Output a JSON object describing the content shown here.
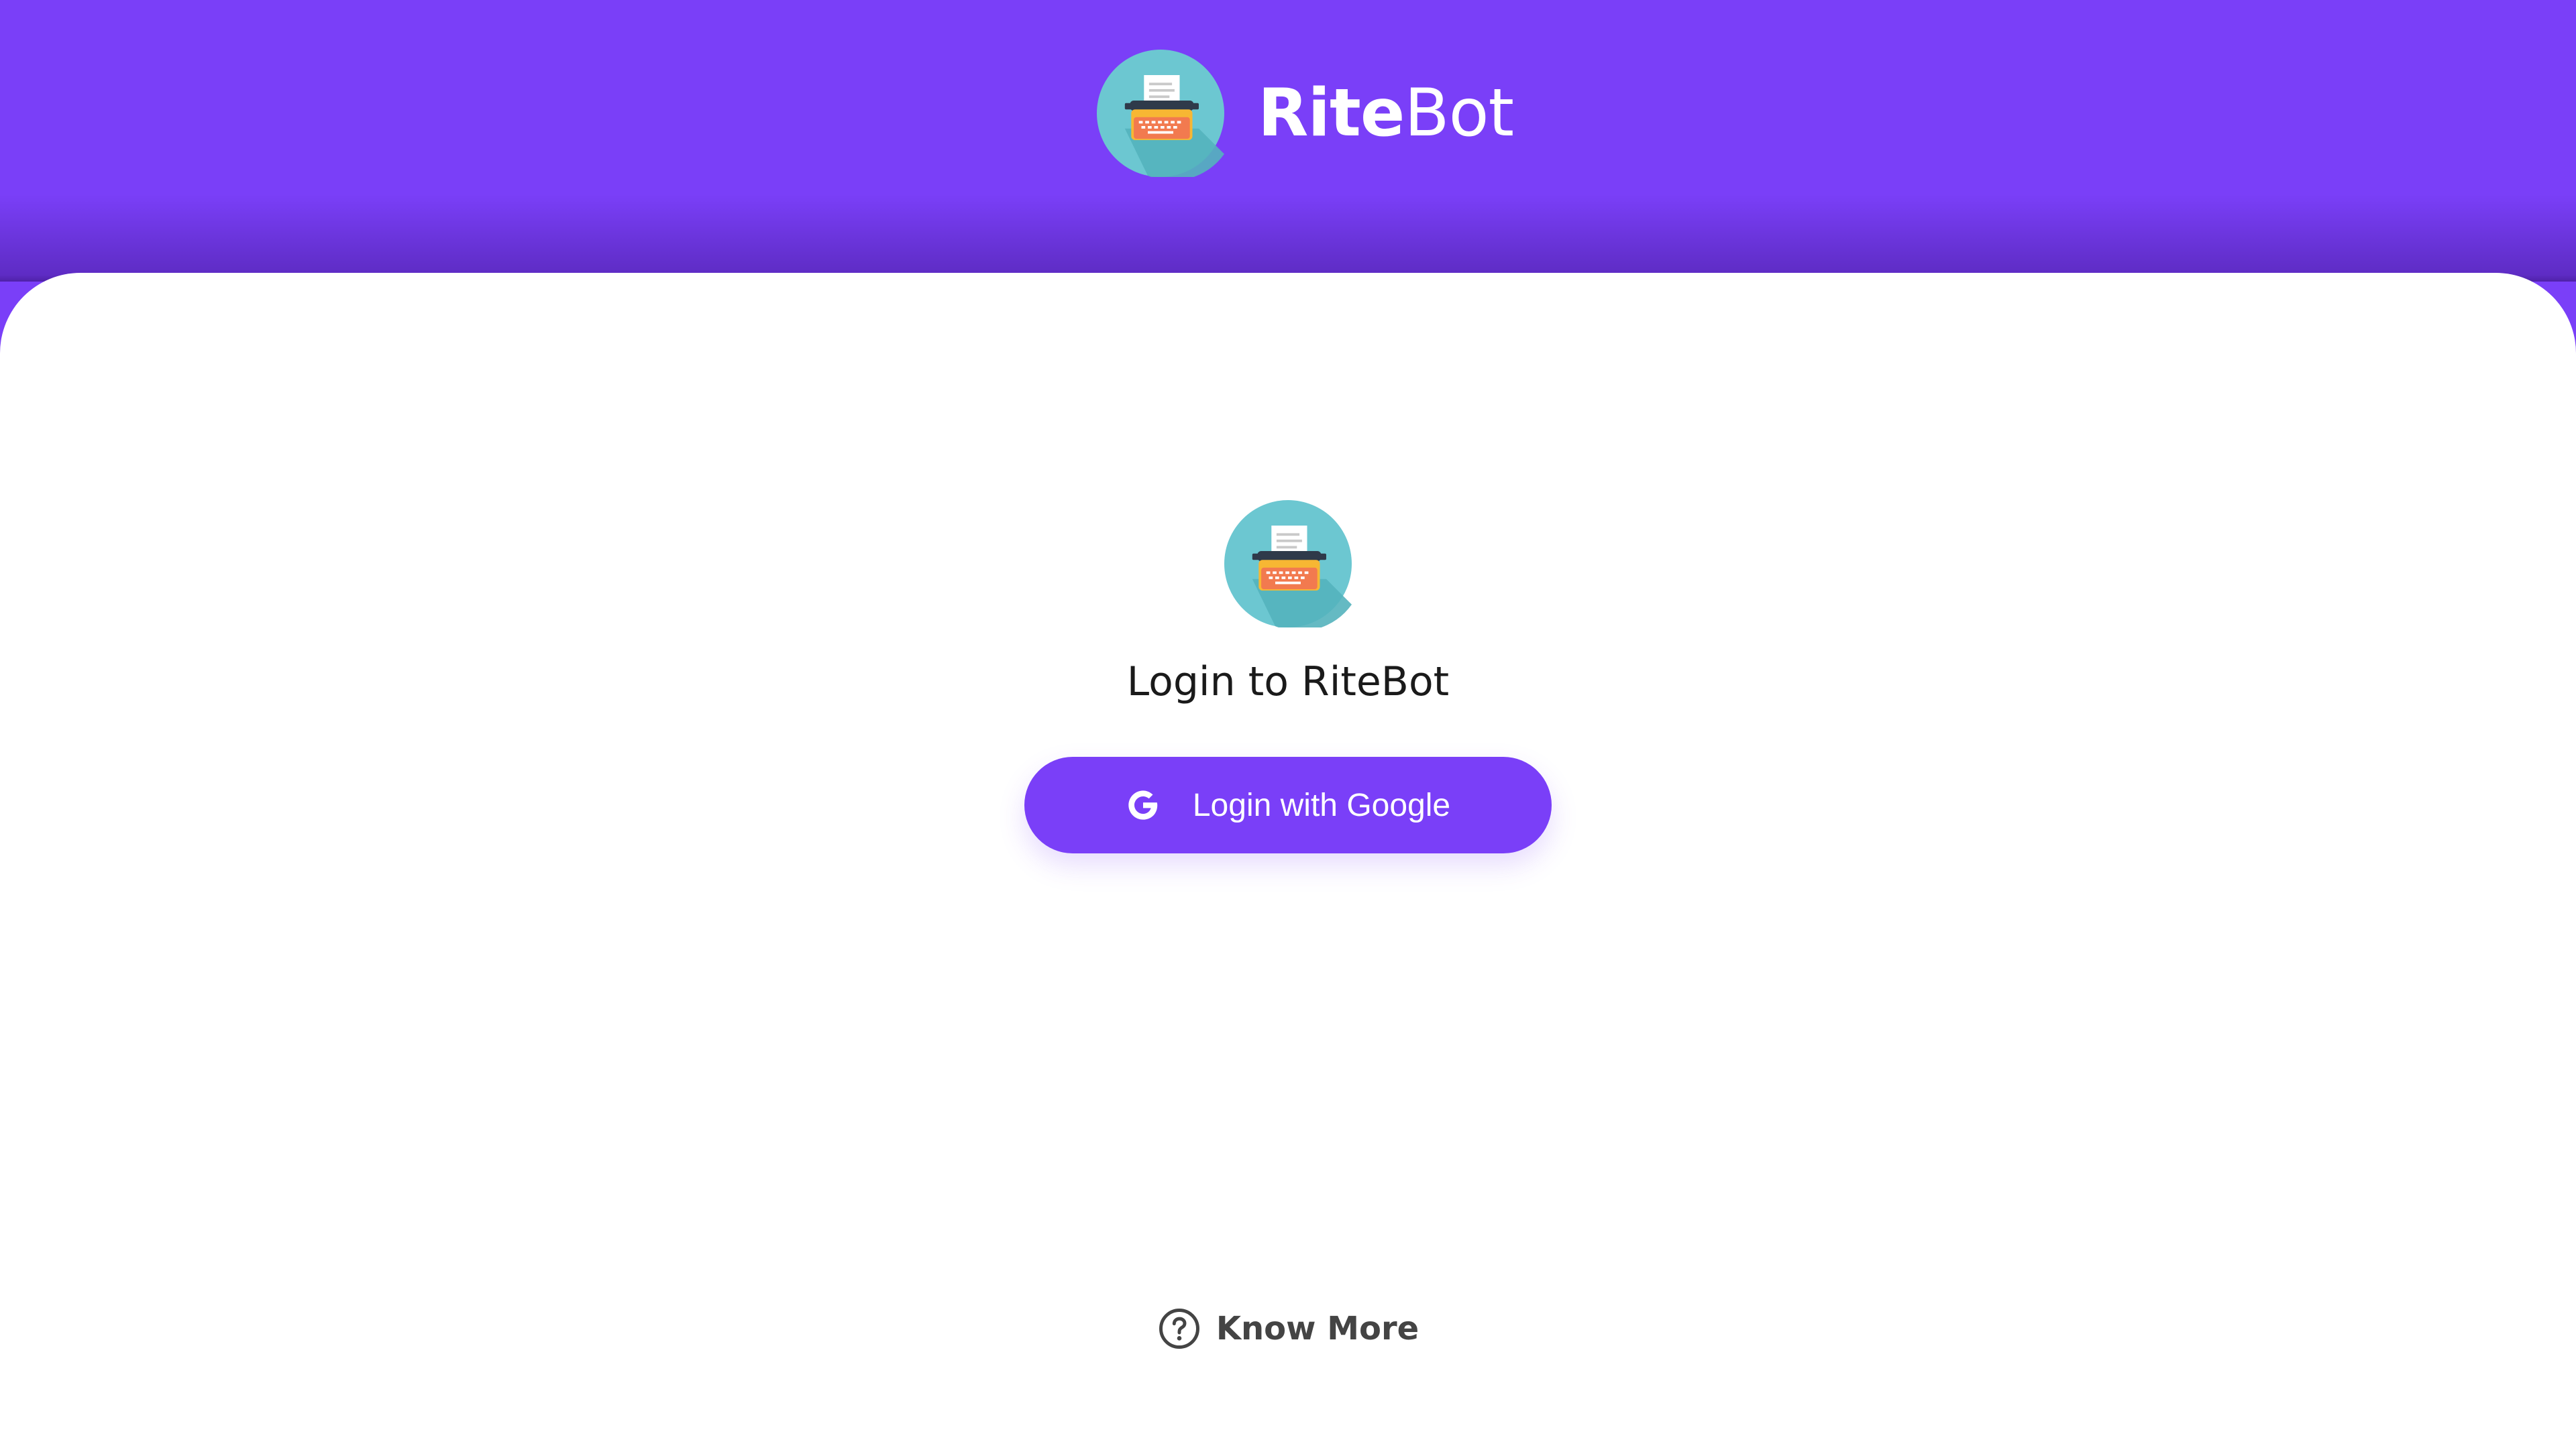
{
  "app": {
    "brand_strong": "Rite",
    "brand_light": "Bot",
    "logo_icon": "typewriter-icon"
  },
  "login": {
    "title": "Login to RiteBot",
    "google_button_label": "Login with Google",
    "google_icon": "google-g-icon"
  },
  "footer": {
    "know_more_label": "Know More",
    "help_icon": "question-circle-icon"
  },
  "colors": {
    "brand_purple": "#7a3ff8",
    "logo_teal": "#6cc7d1",
    "logo_orange": "#f27a4f",
    "text_dark": "#1a1a1a",
    "text_grey": "#444444"
  }
}
